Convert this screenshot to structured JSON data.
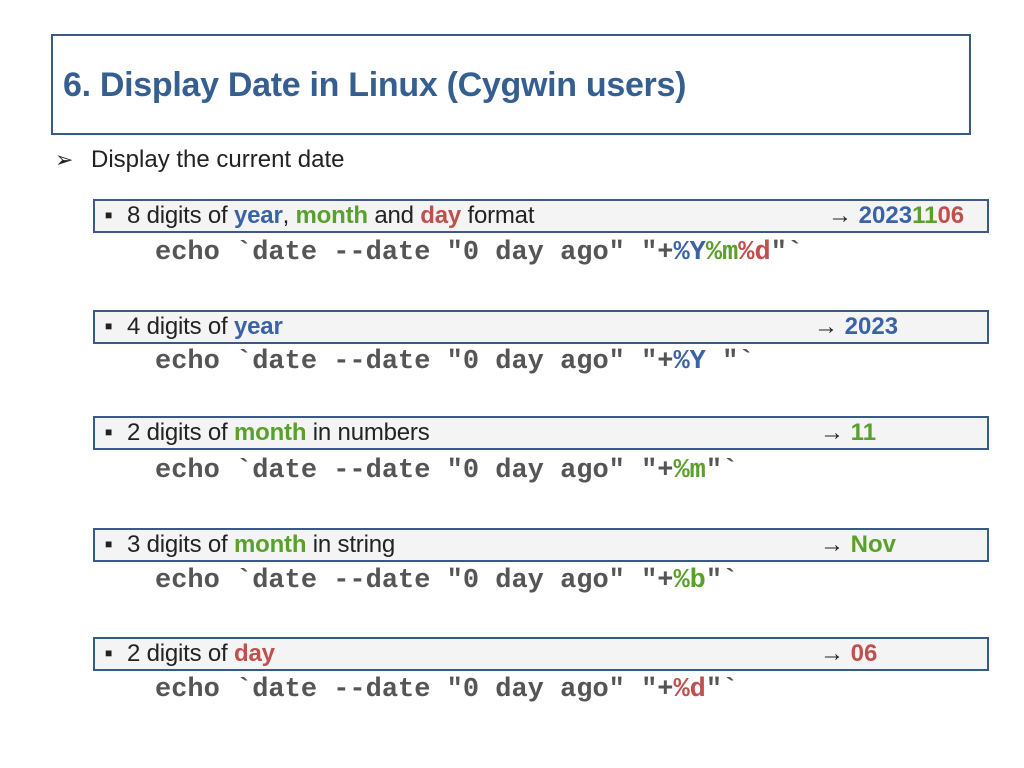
{
  "title": "6. Display Date in Linux (Cygwin users)",
  "bullet": {
    "arrow": "➢",
    "text": "Display the current date"
  },
  "square": "■",
  "items": [
    {
      "desc": {
        "p1": "8 digits of ",
        "year": "year",
        "sep": ",",
        "p2": " ",
        "month": "month",
        "p3": " and ",
        "day": "day",
        "p4": " format"
      },
      "result": {
        "arrow": "→ ",
        "y": "2023",
        "m": "11",
        "d": "06"
      },
      "cmd": {
        "pre": "echo `date --date \"0 day ago\" \"+",
        "fmt1": "%Y",
        "fmt2": "%m",
        "fmt3": "%d",
        "post": "\"`"
      }
    },
    {
      "desc": {
        "p1": "4 digits of ",
        "year": "year"
      },
      "result": {
        "arrow": "→ ",
        "value": "2023"
      },
      "cmd": {
        "pre": "echo `date --date \"0 day ago\" \"+",
        "fmt": "%Y",
        "post": " \"`"
      }
    },
    {
      "desc": {
        "p1": "2 digits of ",
        "month": "month",
        "p2": " in numbers"
      },
      "result": {
        "arrow": "→ ",
        "value": "11"
      },
      "cmd": {
        "pre": "echo `date --date \"0 day ago\" \"+",
        "fmt": "%m",
        "post": "\"`"
      }
    },
    {
      "desc": {
        "p1": "3 digits of ",
        "month": "month",
        "p2": " in string"
      },
      "result": {
        "arrow": "→ ",
        "value": "Nov"
      },
      "cmd": {
        "pre": "echo `date --date \"0 day ago\" \"+",
        "fmt": "%b",
        "post": "\"`"
      }
    },
    {
      "desc": {
        "p1": "2 digits of ",
        "day": "day"
      },
      "result": {
        "arrow": "→ ",
        "value": "06"
      },
      "cmd": {
        "pre": "echo `date --date \"0 day ago\" \"+",
        "fmt": "%d",
        "post": "\"`"
      }
    }
  ],
  "colors": {
    "blue": "#3a63a6",
    "green": "#5aa02c",
    "red": "#c0504d",
    "border": "#3a5a86"
  }
}
